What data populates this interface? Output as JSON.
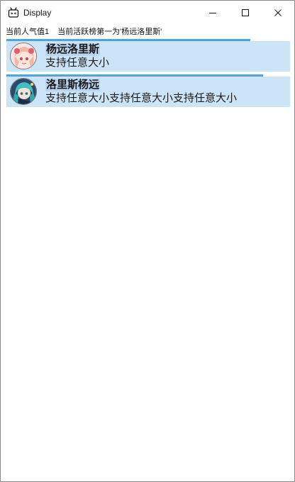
{
  "window": {
    "title": "Display",
    "controls": [
      "minimize-icon",
      "maximize-icon",
      "close-icon"
    ]
  },
  "status": {
    "popularity": "当前人气值1",
    "top_active": "当前活跃榜第一为'杨远洛里斯'"
  },
  "items": [
    {
      "name": "杨远洛里斯",
      "description": "支持任意大小",
      "progress": 0.86,
      "avatar_icon": "anime-avatar-pink"
    },
    {
      "name": "洛里斯杨远",
      "description": "支持任意大小支持任意大小支持任意大小",
      "progress": 0.905,
      "avatar_icon": "anime-avatar-teal"
    }
  ],
  "colors": {
    "item_background": "#cce4f7",
    "progress_bar": "#4da3e6"
  }
}
